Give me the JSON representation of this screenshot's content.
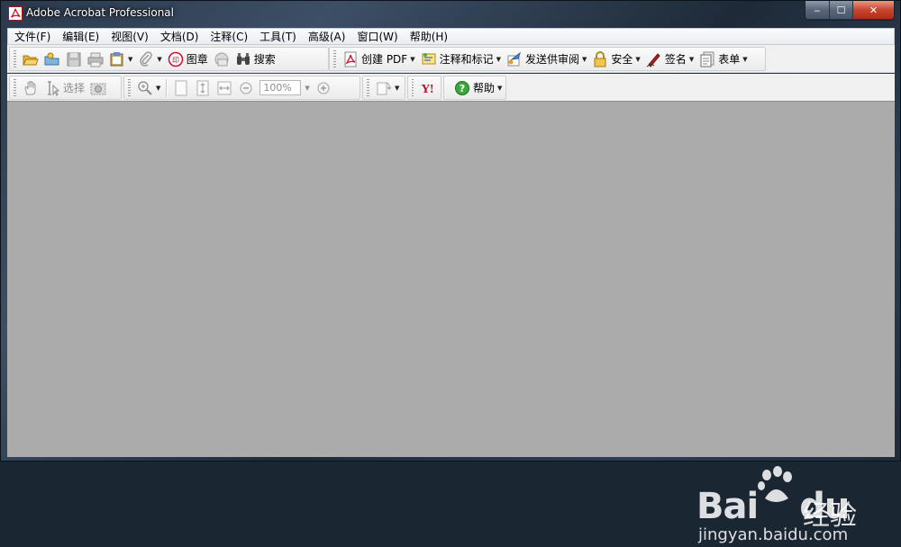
{
  "window": {
    "title": "Adobe Acrobat Professional",
    "caption": {
      "minimize": "‒",
      "maximize": "☐",
      "close": "✕"
    }
  },
  "menu": [
    {
      "label": "文件(F)"
    },
    {
      "label": "编辑(E)"
    },
    {
      "label": "视图(V)"
    },
    {
      "label": "文档(D)"
    },
    {
      "label": "注释(C)"
    },
    {
      "label": "工具(T)"
    },
    {
      "label": "高级(A)"
    },
    {
      "label": "窗口(W)"
    },
    {
      "label": "帮助(H)"
    }
  ],
  "toolbar1": {
    "stamp": "图章",
    "search": "搜索",
    "create_pdf": "创建 PDF",
    "comment_markup": "注释和标记",
    "send_review": "发送供审阅",
    "security": "安全",
    "sign": "签名",
    "forms": "表单"
  },
  "toolbar2": {
    "select": "选择",
    "zoom_value": "100%",
    "help": "帮助"
  },
  "watermark": {
    "brand": "Bai",
    "brand_suffix": "du",
    "product": "经验",
    "url": "jingyan.baidu.com"
  },
  "colors": {
    "document_area": "#ababab",
    "toolbar": "#f0f0f0",
    "acrobat_red": "#c8102e"
  }
}
